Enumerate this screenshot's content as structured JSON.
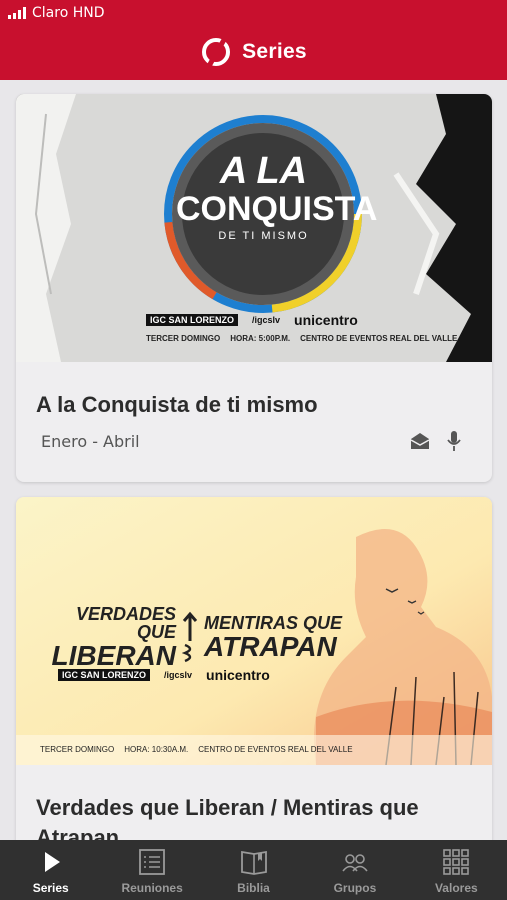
{
  "status_bar": {
    "carrier": "Claro HND"
  },
  "header": {
    "title": "Series"
  },
  "cards": [
    {
      "title": "A la Conquista de ti mismo",
      "subtitle": "Enero - Abril",
      "banner": {
        "headline_line1": "A LA",
        "headline_line2": "CONQUISTA",
        "tagline": "DE TI MISMO",
        "org": "IGC SAN LORENZO",
        "social": "/igcslv",
        "sponsor": "unicentro",
        "info_day": "TERCER DOMINGO",
        "info_time": "HORA: 5:00P.M.",
        "info_place": "CENTRO DE EVENTOS REAL DEL VALLE"
      },
      "actions": [
        "envelope-icon",
        "microphone-icon"
      ]
    },
    {
      "title": "Verdades que Liberan / Mentiras que Atrapan",
      "banner": {
        "left_line1": "VERDADES QUE",
        "left_line2": "LIBERAN",
        "right_line1": "MENTIRAS QUE",
        "right_line2": "ATRAPAN",
        "org": "IGC SAN LORENZO",
        "social": "/igcslv",
        "sponsor": "unicentro",
        "info_day": "TERCER DOMINGO",
        "info_time": "HORA: 10:30A.M.",
        "info_place": "CENTRO DE EVENTOS REAL DEL VALLE"
      }
    }
  ],
  "tabs": [
    {
      "label": "Series",
      "icon": "play-icon",
      "active": true
    },
    {
      "label": "Reuniones",
      "icon": "list-icon",
      "active": false
    },
    {
      "label": "Biblia",
      "icon": "book-icon",
      "active": false
    },
    {
      "label": "Grupos",
      "icon": "group-icon",
      "active": false
    },
    {
      "label": "Valores",
      "icon": "grid-icon",
      "active": false
    }
  ],
  "colors": {
    "header": "#c8102e",
    "tabbar": "#303030",
    "background": "#e8e7ea"
  }
}
